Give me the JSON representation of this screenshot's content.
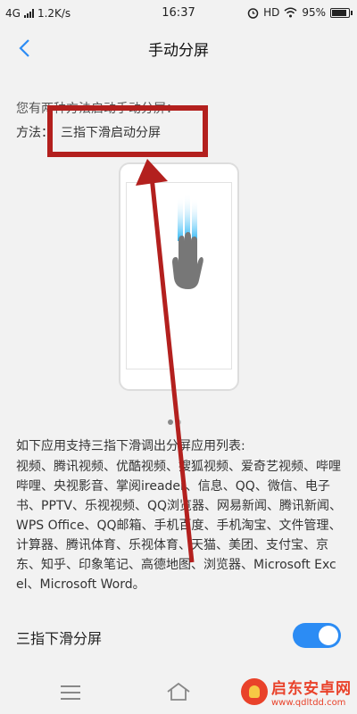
{
  "status_bar": {
    "network": "4G",
    "speed": "1.2K/s",
    "time": "16:37",
    "hd": "HD",
    "battery_percent": "95%",
    "battery_level": 0.95
  },
  "header": {
    "title": "手动分屏"
  },
  "content": {
    "intro": "您有两种方法启动手动分屏：",
    "method_label": "方法：",
    "method_value": "三指下滑启动分屏",
    "carousel_page": 1,
    "carousel_total": 2,
    "apps_title": "如下应用支持三指下滑调出分屏应用列表:",
    "apps_list": "视频、腾讯视频、优酷视频、搜狐视频、爱奇艺视频、哔哩哔哩、央视影音、掌阅ireader、信息、QQ、微信、电子书、PPTV、乐视视频、QQ浏览器、网易新闻、腾讯新闻、WPS Office、QQ邮箱、手机百度、手机淘宝、文件管理、计算器、腾讯体育、乐视体育、天猫、美团、支付宝、京东、知乎、印象笔记、高德地图、浏览器、Microsoft Excel、Microsoft Word。"
  },
  "toggle": {
    "label": "三指下滑分屏",
    "on": true,
    "color": "#2c8cf4"
  },
  "watermark": {
    "name": "启东安卓网",
    "url": "www.qdltdd.com"
  },
  "annotation_color": "#b3201e"
}
